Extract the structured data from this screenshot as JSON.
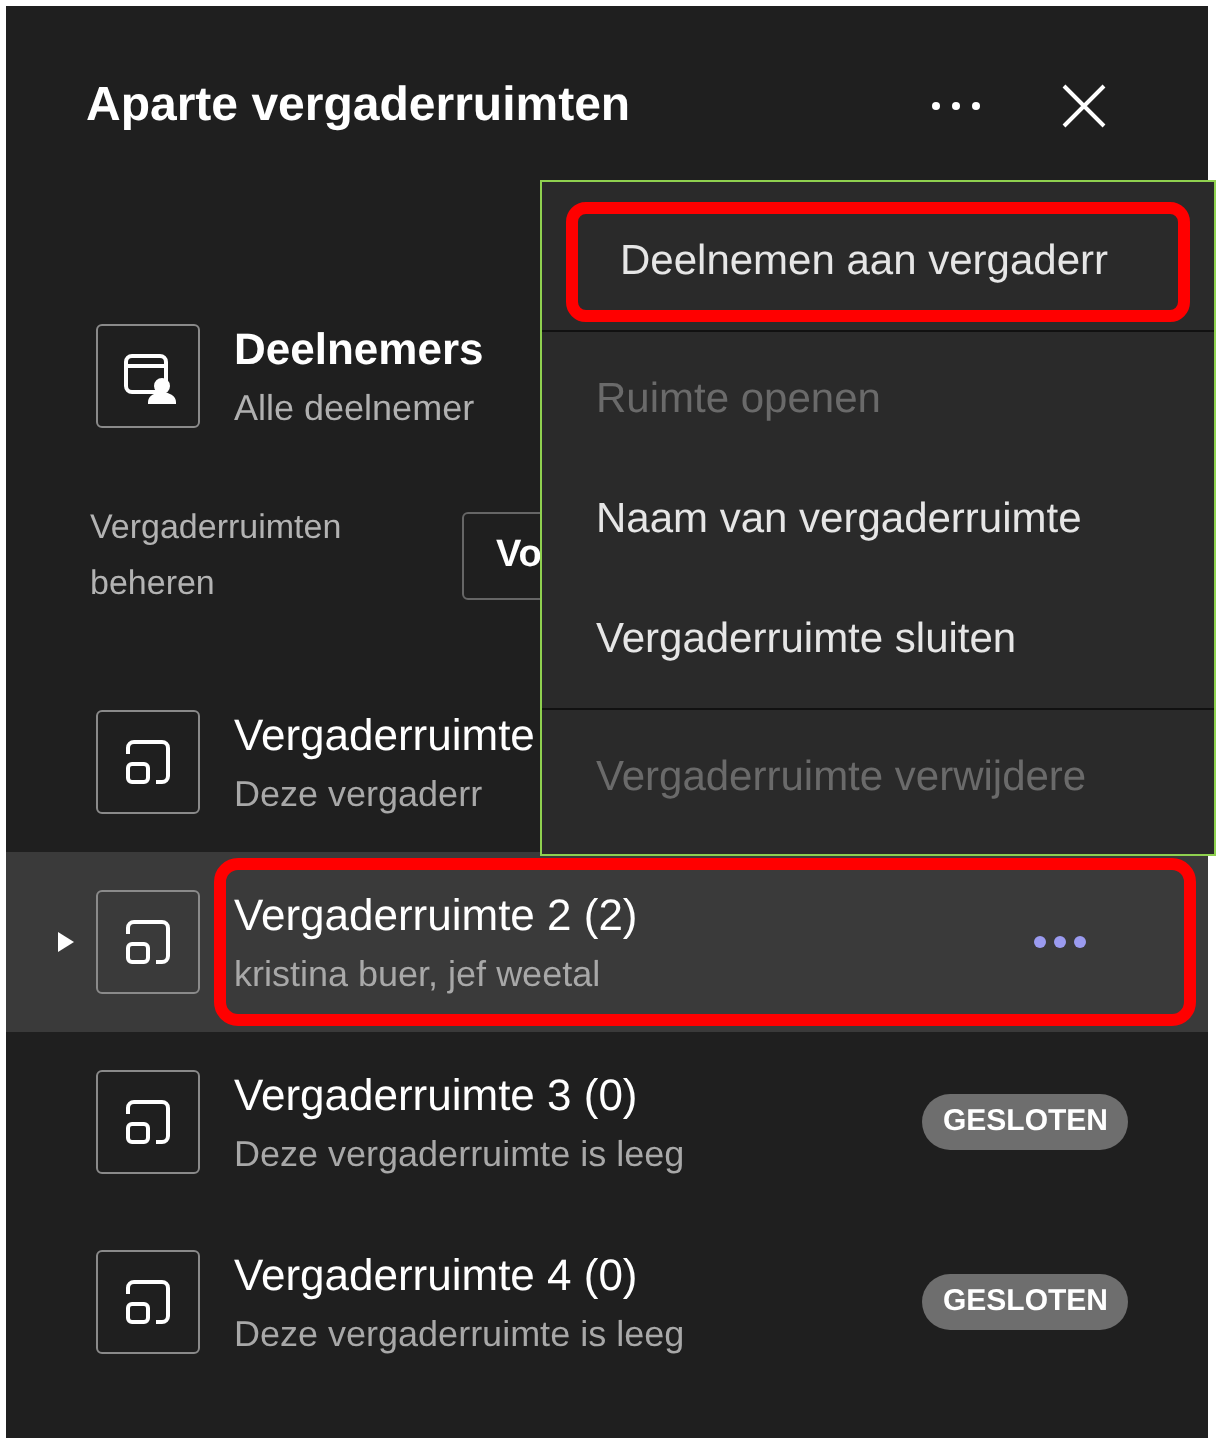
{
  "panel": {
    "title": "Aparte vergaderruimten"
  },
  "participants": {
    "title": "Deelnemers",
    "subtitle": "Alle deelnemer"
  },
  "manage": {
    "label": "Vergaderruimten beheren",
    "button": "Vo"
  },
  "rooms": [
    {
      "name": "Vergaderruimte",
      "subtitle": "Deze vergaderr",
      "selected": false
    },
    {
      "name": "Vergaderruimte 2 (2)",
      "subtitle": "kristina buer, jef weetal",
      "selected": true,
      "highlighted": true
    },
    {
      "name": "Vergaderruimte 3 (0)",
      "subtitle": "Deze vergaderruimte is leeg",
      "selected": false,
      "badge": "GESLOTEN"
    },
    {
      "name": "Vergaderruimte 4 (0)",
      "subtitle": "Deze vergaderruimte is leeg",
      "selected": false,
      "badge": "GESLOTEN"
    }
  ],
  "menu": [
    {
      "label": "Deelnemen aan vergaderr",
      "disabled": false,
      "highlighted": true,
      "divider_after": true
    },
    {
      "label": "Ruimte openen",
      "disabled": true,
      "highlighted": false,
      "divider_after": false
    },
    {
      "label": "Naam van vergaderruimte",
      "disabled": false,
      "highlighted": false,
      "divider_after": false
    },
    {
      "label": "Vergaderruimte sluiten",
      "disabled": false,
      "highlighted": false,
      "divider_after": true
    },
    {
      "label": "Vergaderruimte verwijdere",
      "disabled": true,
      "highlighted": false,
      "divider_after": false
    }
  ]
}
